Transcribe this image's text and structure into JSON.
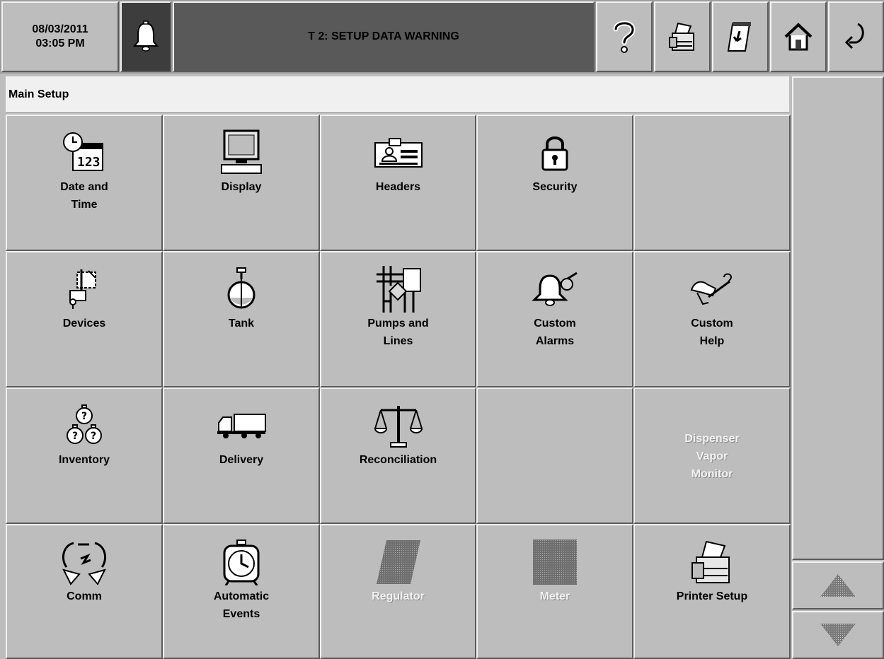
{
  "header": {
    "date": "08/03/2011",
    "time": "03:05 PM",
    "warning_text": "T 2: SETUP DATA WARNING",
    "buttons": [
      {
        "icon": "help-icon"
      },
      {
        "icon": "printer-icon"
      },
      {
        "icon": "receipt-icon"
      },
      {
        "icon": "home-icon"
      },
      {
        "icon": "back-icon"
      }
    ]
  },
  "breadcrumb": "Main Setup",
  "tiles": [
    {
      "label": "Date and\nTime",
      "icon": "calendar-clock-icon",
      "enabled": true
    },
    {
      "label": "Display",
      "icon": "monitor-icon",
      "enabled": true
    },
    {
      "label": "Headers",
      "icon": "id-card-icon",
      "enabled": true
    },
    {
      "label": "Security",
      "icon": "padlock-icon",
      "enabled": true
    },
    {
      "label": "",
      "icon": "",
      "enabled": false
    },
    {
      "label": "Devices",
      "icon": "probe-device-icon",
      "enabled": true
    },
    {
      "label": "Tank",
      "icon": "tank-icon",
      "enabled": true
    },
    {
      "label": "Pumps and\nLines",
      "icon": "pumps-lines-icon",
      "enabled": true
    },
    {
      "label": "Custom\nAlarms",
      "icon": "alarm-bell-icon",
      "enabled": true
    },
    {
      "label": "Custom\nHelp",
      "icon": "custom-help-icon",
      "enabled": true
    },
    {
      "label": "Inventory",
      "icon": "inventory-icon",
      "enabled": true
    },
    {
      "label": "Delivery",
      "icon": "truck-icon",
      "enabled": true
    },
    {
      "label": "Reconciliation",
      "icon": "scales-icon",
      "enabled": true
    },
    {
      "label": "",
      "icon": "",
      "enabled": false
    },
    {
      "label": "Dispenser\nVapor\nMonitor",
      "icon": "",
      "enabled": false
    },
    {
      "label": "Comm",
      "icon": "comm-icon",
      "enabled": true
    },
    {
      "label": "Automatic\nEvents",
      "icon": "alarm-clock-icon",
      "enabled": true
    },
    {
      "label": "Regulator",
      "icon": "regulator-icon",
      "enabled": false
    },
    {
      "label": "Meter",
      "icon": "meter-icon",
      "enabled": false
    },
    {
      "label": "Printer Setup",
      "icon": "printer-icon",
      "enabled": true
    }
  ],
  "scroll": {
    "up_icon": "arrow-up-icon",
    "down_icon": "arrow-down-icon"
  }
}
